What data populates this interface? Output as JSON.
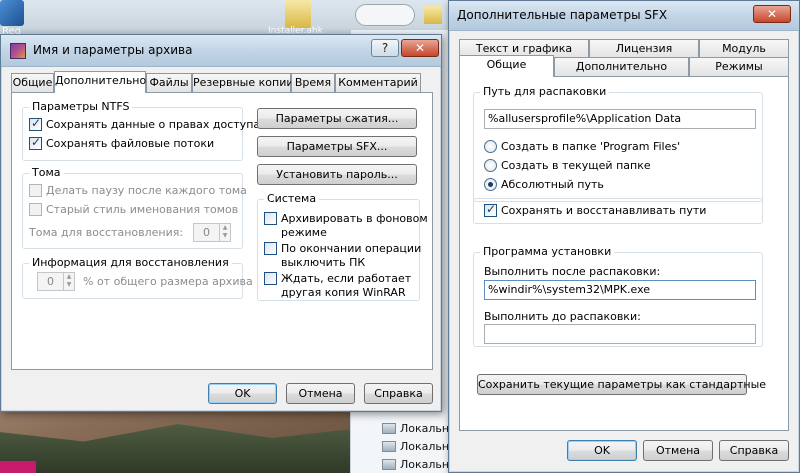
{
  "desktop": {
    "icon_label": "Reg",
    "file_label": "Installer.ahk",
    "explorer_rows": [
      "Локальн",
      "Локальн",
      "Локальн"
    ]
  },
  "archive_dialog": {
    "title": "Имя и параметры архива",
    "help_btn": "?",
    "close_btn": "✕",
    "tabs": [
      "Общие",
      "Дополнительно",
      "Файлы",
      "Резервные копии",
      "Время",
      "Комментарий"
    ],
    "active_tab": 1,
    "ntfs": {
      "title": "Параметры NTFS",
      "items": [
        {
          "label": "Сохранять данные о правах доступа",
          "checked": true
        },
        {
          "label": "Сохранять файловые потоки",
          "checked": true
        }
      ]
    },
    "volumes": {
      "title": "Тома",
      "items": [
        {
          "label": "Делать паузу после каждого тома",
          "checked": false
        },
        {
          "label": "Старый стиль именования томов",
          "checked": false
        }
      ],
      "recovery_volumes_label": "Тома для восстановления:",
      "recovery_volumes_value": "0"
    },
    "recovery_info": {
      "title": "Информация для восстановления",
      "value": "0",
      "suffix": "% от общего размера архива"
    },
    "buttons_right": {
      "compression": "Параметры сжатия...",
      "sfx": "Параметры SFX...",
      "password": "Установить пароль..."
    },
    "system": {
      "title": "Система",
      "items": [
        {
          "label": "Архивировать в фоновом\nрежиме",
          "checked": false
        },
        {
          "label": "По окончании операции\nвыключить ПК",
          "checked": false
        },
        {
          "label": "Ждать, если работает\nдругая копия WinRAR",
          "checked": false
        }
      ]
    },
    "footer": {
      "ok": "OK",
      "cancel": "Отмена",
      "help": "Справка"
    }
  },
  "sfx_dialog": {
    "title": "Дополнительные параметры SFX",
    "close_btn": "✕",
    "tabs_back": [
      "Текст и графика",
      "Лицензия",
      "Модуль"
    ],
    "tabs_front": [
      "Общие",
      "Дополнительно",
      "Режимы"
    ],
    "extract_path": {
      "title": "Путь для распаковки",
      "value": "%allusersprofile%\\Application Data",
      "radios": [
        {
          "label": "Создать в папке 'Program Files'",
          "checked": false
        },
        {
          "label": "Создать в текущей папке",
          "checked": false
        },
        {
          "label": "Абсолютный путь",
          "checked": true
        }
      ]
    },
    "save_paths": {
      "label": "Сохранять и восстанавливать пути",
      "checked": true
    },
    "setup": {
      "title": "Программа установки",
      "after_label": "Выполнить после распаковки:",
      "after_value": "%windir%\\system32\\MPK.exe",
      "before_label": "Выполнить до распаковки:",
      "before_value": ""
    },
    "save_defaults": "Сохранить текущие параметры как стандартные",
    "footer": {
      "ok": "OK",
      "cancel": "Отмена",
      "help": "Справка"
    }
  }
}
